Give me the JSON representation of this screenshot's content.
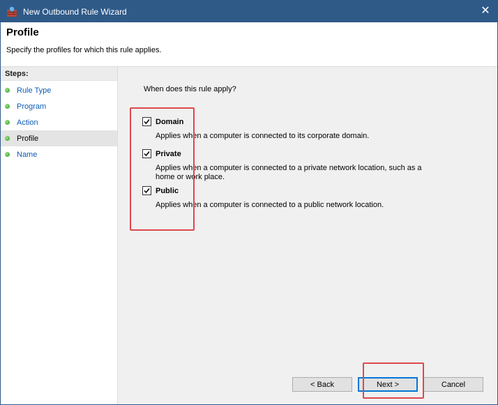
{
  "window": {
    "title": "New Outbound Rule Wizard",
    "close_glyph": "✕"
  },
  "header": {
    "title": "Profile",
    "description": "Specify the profiles for which this rule applies."
  },
  "sidebar": {
    "heading": "Steps:",
    "items": [
      {
        "label": "Rule Type",
        "active": false
      },
      {
        "label": "Program",
        "active": false
      },
      {
        "label": "Action",
        "active": false
      },
      {
        "label": "Profile",
        "active": true
      },
      {
        "label": "Name",
        "active": false
      }
    ]
  },
  "main": {
    "question": "When does this rule apply?",
    "options": [
      {
        "label": "Domain",
        "checked": true,
        "description": "Applies when a computer is connected to its corporate domain."
      },
      {
        "label": "Private",
        "checked": true,
        "description": "Applies when a computer is connected to a private network location, such as a home or work place."
      },
      {
        "label": "Public",
        "checked": true,
        "description": "Applies when a computer is connected to a public network location."
      }
    ]
  },
  "buttons": {
    "back": "< Back",
    "next": "Next >",
    "cancel": "Cancel"
  },
  "colors": {
    "titlebar": "#2f5a88",
    "highlight": "#e0474c",
    "link": "#0d5bb5",
    "step_dot": "#2d9a1e"
  }
}
